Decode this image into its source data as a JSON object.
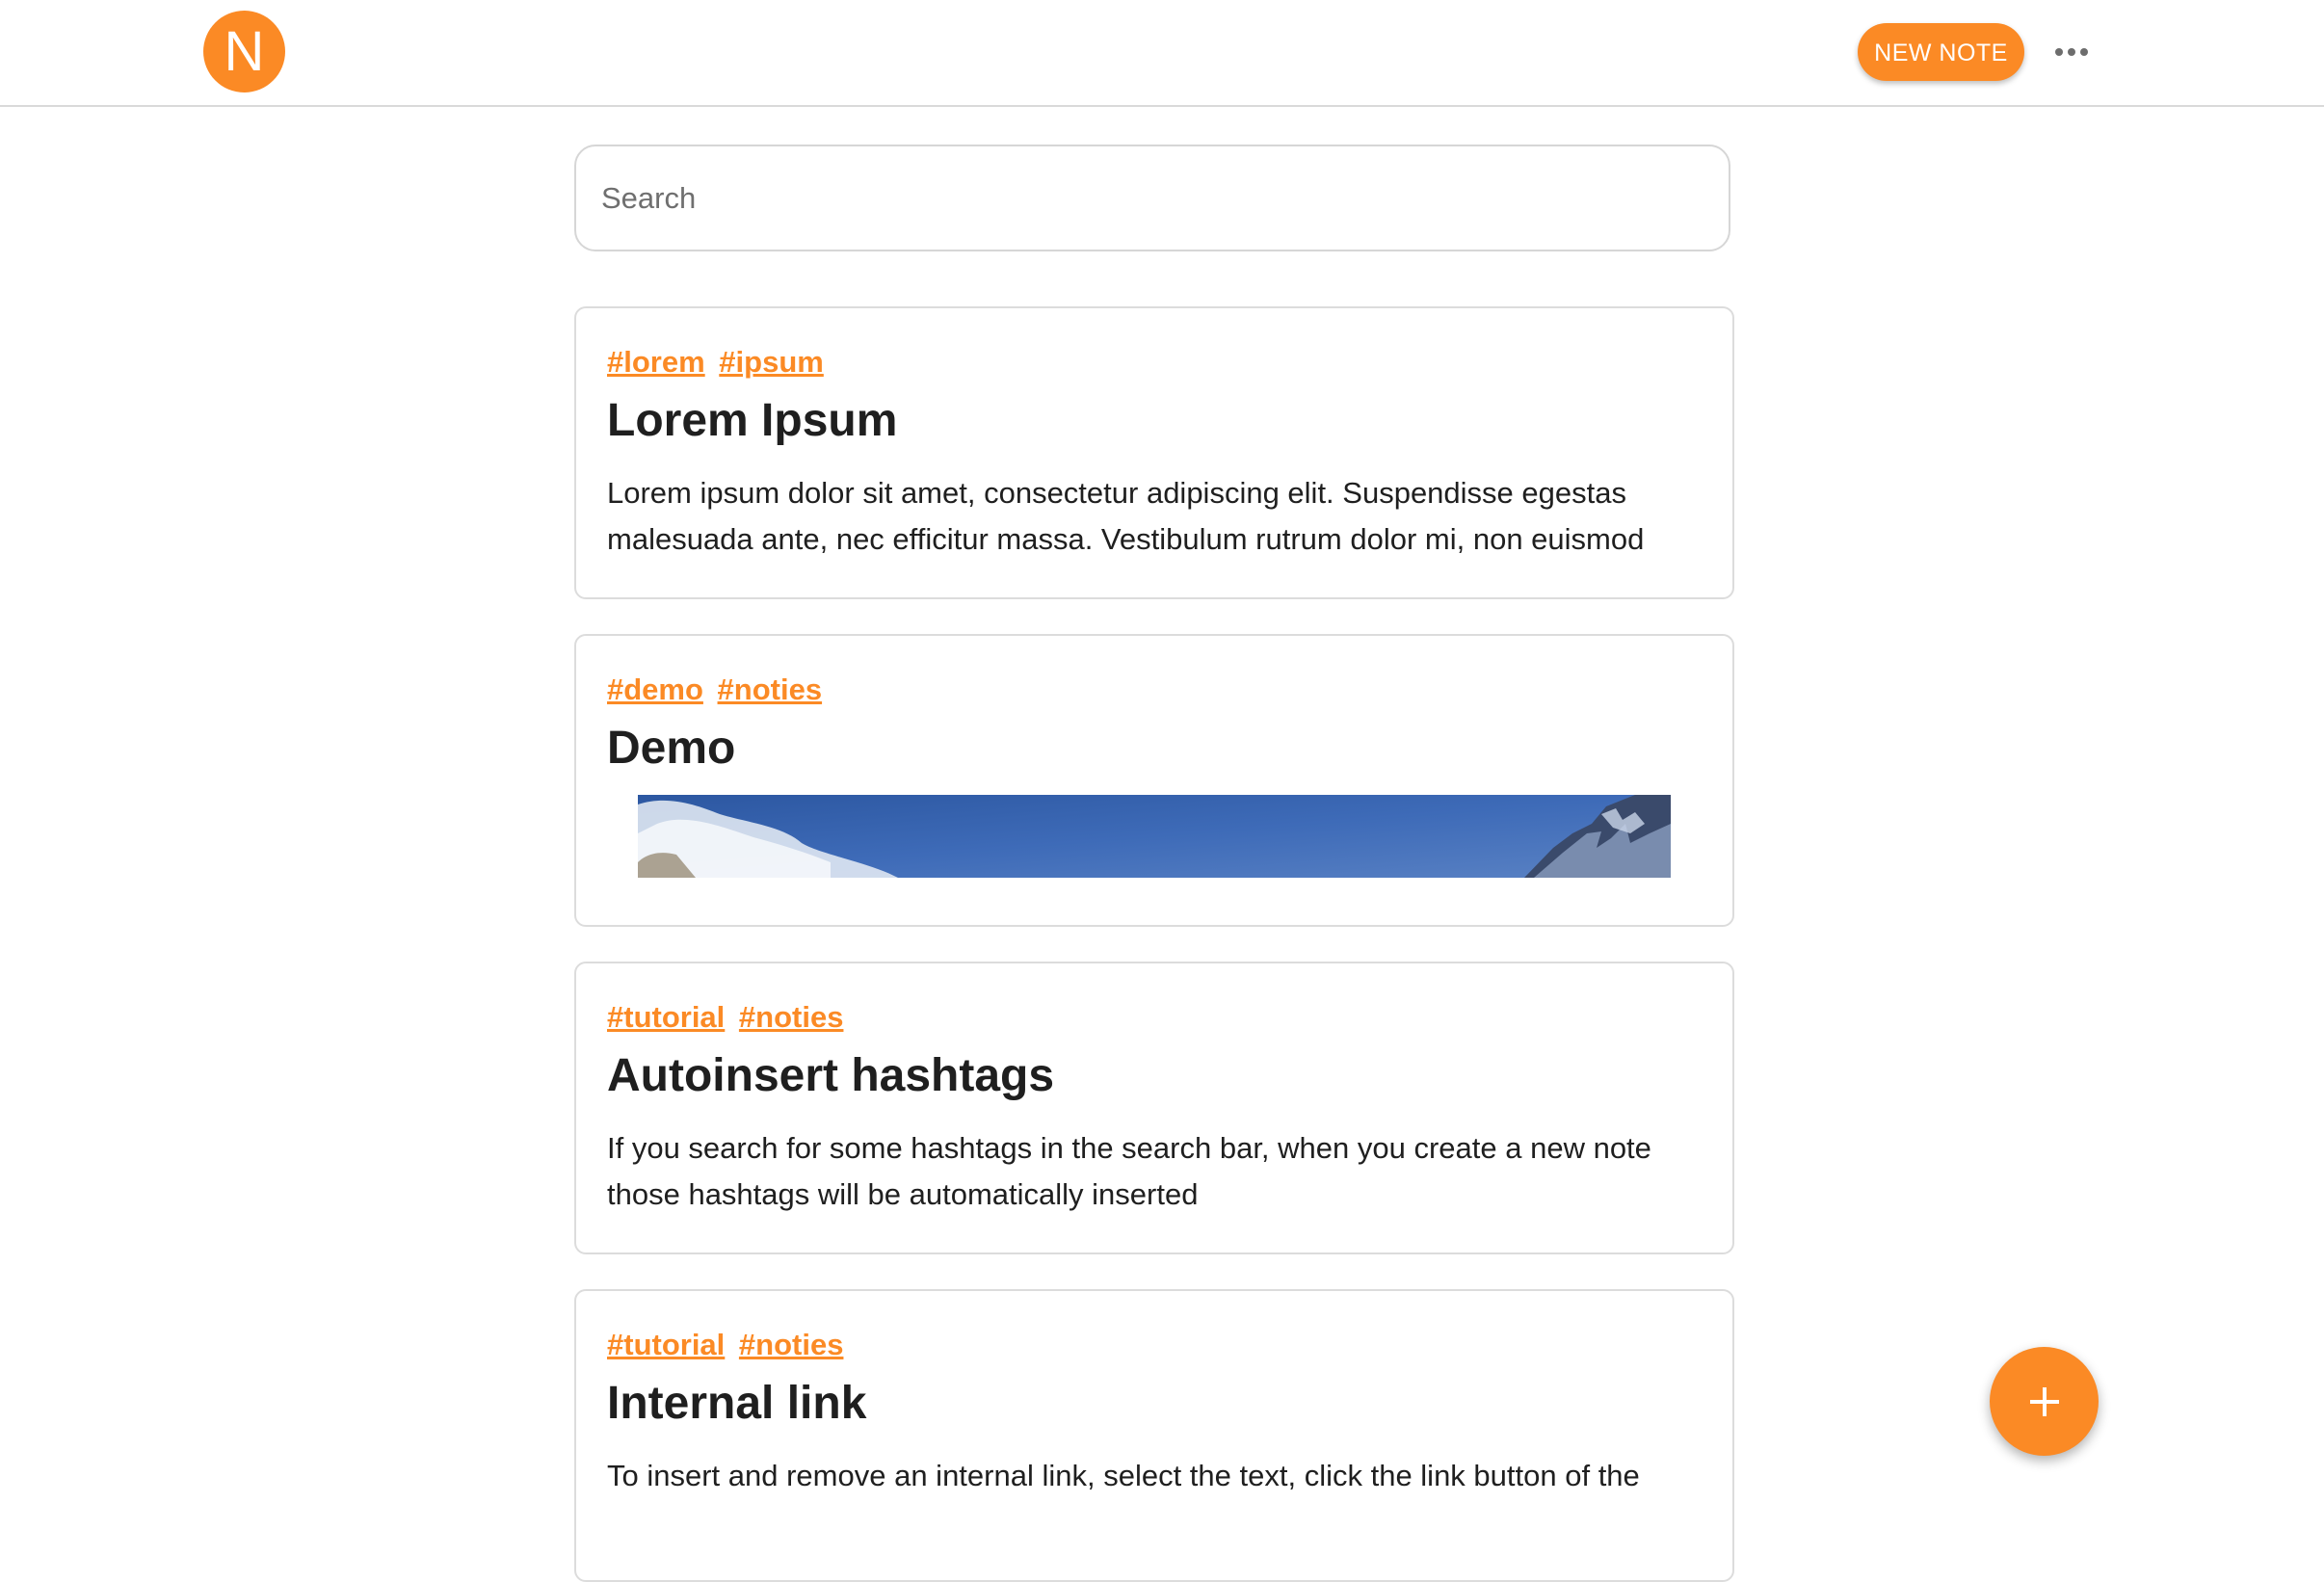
{
  "header": {
    "logo_letter": "N",
    "new_note_label": "NEW NOTE",
    "accent_color": "#fb8a25"
  },
  "search": {
    "placeholder": "Search",
    "value": ""
  },
  "notes": [
    {
      "tags": [
        "#lorem",
        "#ipsum"
      ],
      "title": "Lorem Ipsum",
      "body": "Lorem ipsum dolor sit amet, consectetur adipiscing elit. Suspendisse egestas malesuada ante, nec efficitur massa. Vestibulum rutrum dolor mi, non euismod"
    },
    {
      "tags": [
        "#demo",
        "#noties"
      ],
      "title": "Demo",
      "image": "mountain-sky-image"
    },
    {
      "tags": [
        "#tutorial",
        "#noties"
      ],
      "title": "Autoinsert hashtags",
      "body": "If you search for some hashtags in the search bar, when you create a new note those hashtags will be automatically inserted"
    },
    {
      "tags": [
        "#tutorial",
        "#noties"
      ],
      "title": "Internal link",
      "body": "To insert and remove an internal link, select the text, click the link button of the"
    }
  ],
  "fab": {
    "icon": "plus-icon"
  }
}
